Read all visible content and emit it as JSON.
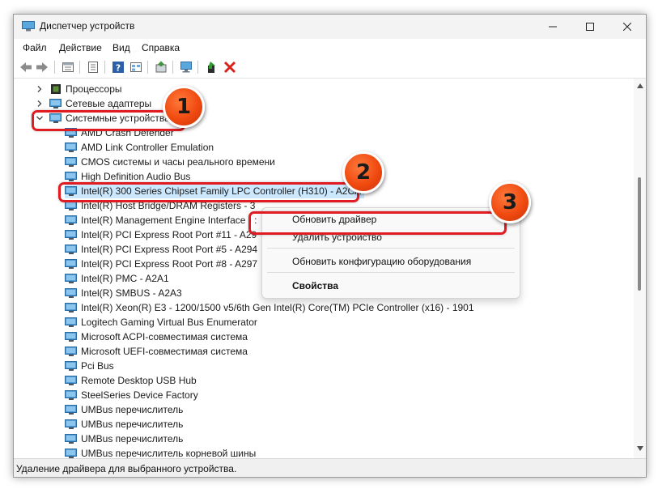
{
  "window": {
    "title": "Диспетчер устройств",
    "controls": {
      "minimize": "—",
      "maximize": "☐",
      "close": "✕"
    }
  },
  "menu": [
    "Файл",
    "Действие",
    "Вид",
    "Справка"
  ],
  "toolbar": {
    "buttons": [
      "back-icon",
      "forward-icon",
      "properties-icon",
      "driver-file-icon",
      "help-icon",
      "view-icon",
      "update-driver-icon",
      "scan-hardware-icon",
      "enable-device-icon",
      "uninstall-device-icon"
    ]
  },
  "tree": {
    "categories": [
      {
        "label": "Процессоры",
        "expanded": false
      },
      {
        "label": "Сетевые адаптеры",
        "expanded": false
      },
      {
        "label": "Системные устройства",
        "expanded": true
      }
    ],
    "devices": [
      "AMD Crash Defender",
      "AMD Link Controller Emulation",
      "CMOS системы и часы реального времени",
      "High Definition Audio Bus",
      "Intel(R) 300 Series Chipset Family LPC Controller (H310) - A2CA",
      "Intel(R) Host Bridge/DRAM Registers - 3",
      "Intel(R) Management Engine Interface - :",
      "Intel(R) PCI Express Root Port #11 - A29",
      "Intel(R) PCI Express Root Port #5 - A294",
      "Intel(R) PCI Express Root Port #8 - A297",
      "Intel(R) PMC - A2A1",
      "Intel(R) SMBUS - A2A3",
      "Intel(R) Xeon(R) E3 - 1200/1500 v5/6th Gen Intel(R) Core(TM) PCIe Controller (x16) - 1901",
      "Logitech Gaming Virtual Bus Enumerator",
      "Microsoft ACPI-совместимая система",
      "Microsoft UEFI-совместимая система",
      "Pci Bus",
      "Remote Desktop USB Hub",
      "SteelSeries Device Factory",
      "UMBus перечислитель",
      "UMBus перечислитель",
      "UMBus перечислитель",
      "UMBus перечислитель корневой шины"
    ],
    "selected_index": 4
  },
  "context_menu": {
    "items": [
      "Обновить драйвер",
      "Удалить устройство",
      "Обновить конфигурацию оборудования",
      "Свойства"
    ]
  },
  "status": {
    "text": "Удаление драйвера для выбранного устройства."
  },
  "annotations": {
    "steps": [
      "1",
      "2",
      "3"
    ]
  },
  "colors": {
    "highlight": "#e11b22",
    "badge": "#f04a10",
    "selection": "#cce8ff"
  }
}
